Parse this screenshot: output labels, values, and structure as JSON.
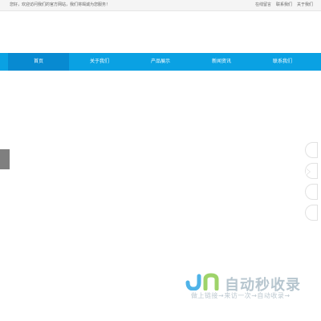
{
  "topbar": {
    "welcome": "您好，欢迎访问我们的官方网站，我们将竭诚为您服务！",
    "links": [
      "在线留言",
      "联系我们",
      "关于我们"
    ]
  },
  "nav": {
    "items": [
      "首页",
      "关于我们",
      "产品展示",
      "新闻资讯",
      "联系我们"
    ],
    "active_index": 0
  },
  "watermark": {
    "brand": "JN自动秒收录",
    "slogan": "做上链接→来访一次→自动收录→"
  },
  "colors": {
    "nav": "#0aa1e3",
    "nav_active": "#088ad1",
    "watermark_j": "#4fb3e8",
    "watermark_n": "#9ed36a"
  }
}
